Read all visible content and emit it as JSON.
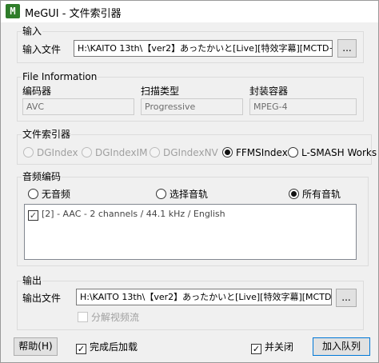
{
  "window": {
    "title": "MeGUI - 文件索引器",
    "icon_text": "M"
  },
  "input_group": {
    "label": "输入",
    "file_label": "输入文件",
    "file_value": "H:\\KAITO 13th\\【ver2】あったかいと[Live][特效字幕][MCTD+",
    "browse_label": "..."
  },
  "file_info": {
    "label": "File Information",
    "codec_label": "编码器",
    "codec_value": "AVC",
    "scan_label": "扫描类型",
    "scan_value": "Progressive",
    "container_label": "封装容器",
    "container_value": "MPEG-4"
  },
  "indexer": {
    "label": "文件索引器",
    "options": [
      {
        "label": "DGIndex",
        "checked": false,
        "disabled": true
      },
      {
        "label": "DGIndexIM",
        "checked": false,
        "disabled": true
      },
      {
        "label": "DGIndexNV",
        "checked": false,
        "disabled": true
      },
      {
        "label": "FFMSIndex",
        "checked": true,
        "disabled": false
      },
      {
        "label": "L-SMASH Works",
        "checked": false,
        "disabled": false
      }
    ]
  },
  "audio": {
    "label": "音频编码",
    "options": [
      {
        "label": "无音频",
        "checked": false
      },
      {
        "label": "选择音轨",
        "checked": false
      },
      {
        "label": "所有音轨",
        "checked": true
      }
    ],
    "tracks": [
      {
        "label": "[2] - AAC - 2 channels / 44.1 kHz / English",
        "checked": true
      }
    ]
  },
  "output_group": {
    "label": "输出",
    "file_label": "输出文件",
    "file_value": "H:\\KAITO 13th\\【ver2】あったかいと[Live][特效字幕][MCTD",
    "browse_label": "...",
    "demux_label": "分解视频流"
  },
  "footer": {
    "help_label": "帮助(H)",
    "load_after_label": "完成后加载",
    "close_label": "并关闭",
    "queue_label": "加入队列"
  },
  "colors": {
    "window_bg": "#f0f0f0",
    "titlebar_bg": "#ffffff",
    "focus_border": "#0078d7",
    "icon_green": "#2f7d2a"
  }
}
